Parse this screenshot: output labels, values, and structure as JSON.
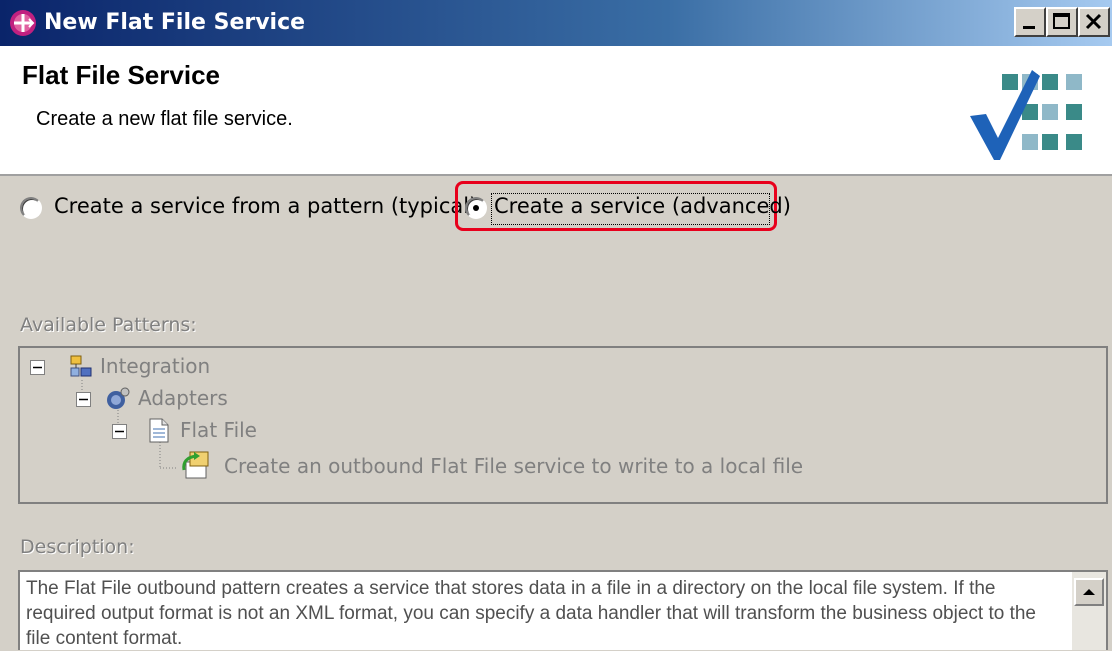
{
  "window": {
    "title": "New Flat File Service"
  },
  "header": {
    "title": "Flat File Service",
    "subtitle": "Create a new flat file service."
  },
  "options": {
    "pattern_label": "Create a service from a pattern (typical)",
    "advanced_label": "Create a service (advanced)",
    "selected": "advanced"
  },
  "patterns": {
    "label": "Available Patterns:",
    "tree": {
      "root": "Integration",
      "child": "Adapters",
      "grandchild": "Flat File",
      "leaf": "Create an outbound Flat File service to write to a local file"
    }
  },
  "description": {
    "label": "Description:",
    "text": "The Flat File outbound pattern creates a service that stores data in a file in a directory on the local file system. If the required output format is not an XML format, you can specify a data handler that will transform the business object to the file content format."
  },
  "colors": {
    "highlight": "#e8001c",
    "titlebar": "#0a246a"
  }
}
